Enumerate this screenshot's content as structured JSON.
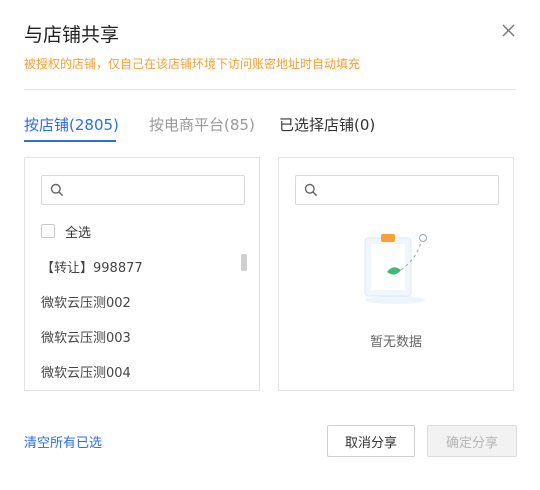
{
  "dialog": {
    "title": "与店铺共享",
    "subtitle": "被授权的店铺，仅自己在该店铺环境下访问账密地址时自动填充"
  },
  "tabs": [
    {
      "label": "按店铺(2805)",
      "active": true
    },
    {
      "label": "按电商平台(85)",
      "active": false
    },
    {
      "label": "已选择店铺(0)",
      "active": false
    }
  ],
  "left_panel": {
    "search": {
      "placeholder": "",
      "value": ""
    },
    "select_all_label": "全选",
    "items": [
      {
        "label": "【转让】998877"
      },
      {
        "label": "微软云压测002"
      },
      {
        "label": "微软云压测003"
      },
      {
        "label": "微软云压测004"
      }
    ]
  },
  "right_panel": {
    "search": {
      "placeholder": "",
      "value": ""
    },
    "empty_text": "暂无数据"
  },
  "footer": {
    "clear_label": "清空所有已选",
    "cancel_label": "取消分享",
    "confirm_label": "确定分享"
  },
  "colors": {
    "accent": "#2c6ee0",
    "warning_text": "#f0a13a",
    "disabled_text": "#b5b5b5"
  },
  "icons": [
    "close-icon",
    "search-icon",
    "empty-clipboard-illustration"
  ]
}
